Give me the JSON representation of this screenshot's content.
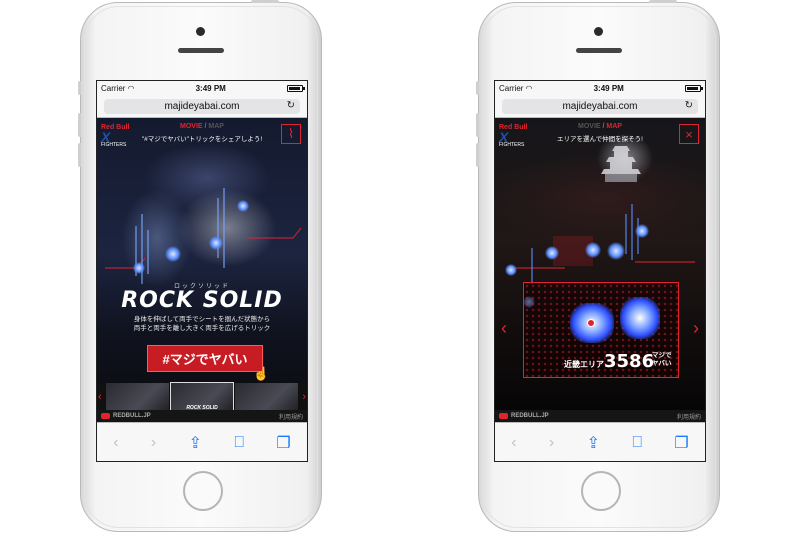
{
  "phones": [
    {
      "status": {
        "carrier": "Carrier",
        "time": "3:49 PM"
      },
      "url": "majideyabai.com",
      "page": {
        "logo": {
          "brand": "Red Bull",
          "mark": "X",
          "sub": "FIGHTERS"
        },
        "nav": {
          "movie": "MOVIE",
          "sep": "/",
          "map": "MAP"
        },
        "subtitle": "\"#マジでヤバい\"トリックをシェアしよう!",
        "trick_kana": "ロックソリッド",
        "trick_name": "ROCK SOLID",
        "description": [
          "身体を伸ばして両手でシートを掴んだ状態から",
          "両手と両手を離し大きく両手を広げるトリック"
        ],
        "cta": "#マジでヤバい",
        "thumbnail_caption": "ROCK SOLID",
        "footer_brand": "REDBULL.JP",
        "footer_link": "利用規約"
      }
    },
    {
      "status": {
        "carrier": "Carrier",
        "time": "3:49 PM"
      },
      "url": "majideyabai.com",
      "page": {
        "logo": {
          "brand": "Red Bull",
          "mark": "X",
          "sub": "FIGHTERS"
        },
        "nav": {
          "movie": "MOVIE",
          "sep": "/",
          "map": "MAP"
        },
        "subtitle": "エリアを選んで仲間を探そう!",
        "close": "×",
        "area_label": "近畿エリア",
        "area_count": "3586",
        "count_unit": [
          "マジで",
          "ヤバい"
        ],
        "footer_brand": "REDBULL.JP",
        "footer_link": "利用規約"
      }
    }
  ],
  "icons": {
    "reload": "reload-icon",
    "back": "back-icon",
    "forward": "forward-icon",
    "share": "share-icon",
    "bookmarks": "bookmarks-icon",
    "tabs": "tabs-icon"
  },
  "colors": {
    "accent": "#e0242f",
    "ios_blue": "#1a7bff"
  }
}
